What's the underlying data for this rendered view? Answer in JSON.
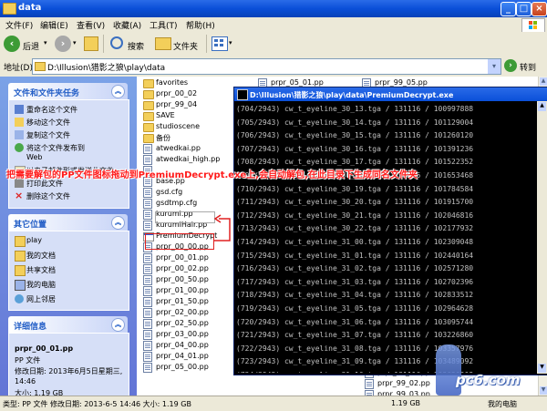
{
  "window": {
    "title": "data"
  },
  "menu": [
    "文件(F)",
    "编辑(E)",
    "查看(V)",
    "收藏(A)",
    "工具(T)",
    "帮助(H)"
  ],
  "toolbar": {
    "back": "后退",
    "search": "搜索",
    "folders": "文件夹"
  },
  "address": {
    "label": "地址(D)",
    "path": "D:\\Illusion\\猎影之狼\\play\\data",
    "go": "转到"
  },
  "tasks": {
    "title": "文件和文件夹任务",
    "items": [
      {
        "label": "重命名这个文件",
        "icon": "rename-icon"
      },
      {
        "label": "移动这个文件",
        "icon": "move-icon"
      },
      {
        "label": "复制这个文件",
        "icon": "copy-icon"
      },
      {
        "label": "将这个文件发布到",
        "label2": "Web",
        "icon": "publish-icon"
      },
      {
        "label": "以电子邮件形式发送此文件",
        "icon": "email-icon"
      },
      {
        "label": "打印此文件",
        "icon": "print-icon"
      },
      {
        "label": "删除这个文件",
        "icon": "delete-icon"
      }
    ]
  },
  "places": {
    "title": "其它位置",
    "items": [
      {
        "label": "play",
        "icon": "folder-icon"
      },
      {
        "label": "我的文档",
        "icon": "my-documents-icon"
      },
      {
        "label": "共享文档",
        "icon": "shared-documents-icon"
      },
      {
        "label": "我的电脑",
        "icon": "my-computer-icon"
      },
      {
        "label": "网上邻居",
        "icon": "network-icon"
      }
    ]
  },
  "details": {
    "title": "详细信息",
    "filename": "prpr_00_01.pp",
    "type": "PP 文件",
    "modified": "修改日期: 2013年6月5日星期三, 14:46",
    "size": "大小: 1.19 GB"
  },
  "files_col1": [
    {
      "name": "favorites",
      "kind": "folder"
    },
    {
      "name": "prpr_00_02",
      "kind": "folder"
    },
    {
      "name": "prpr_99_04",
      "kind": "folder"
    },
    {
      "name": "SAVE",
      "kind": "folder"
    },
    {
      "name": "studioscene",
      "kind": "folder"
    },
    {
      "name": "备份",
      "kind": "folder"
    },
    {
      "name": "atwedkai.pp",
      "kind": "doc"
    },
    {
      "name": "atwedkai_high.pp",
      "kind": "doc"
    },
    {
      "name": "",
      "kind": "doc"
    },
    {
      "name": "base.pp",
      "kind": "doc"
    },
    {
      "name": "gsd.cfg",
      "kind": "doc"
    },
    {
      "name": "gsdtmp.cfg",
      "kind": "doc"
    },
    {
      "name": "kurumi.pp",
      "kind": "doc"
    },
    {
      "name": "kurumiHair.pp",
      "kind": "doc"
    },
    {
      "name": "PremiumDecrypt",
      "kind": "exe"
    },
    {
      "name": "prpr_00_00.pp",
      "kind": "doc"
    },
    {
      "name": "prpr_00_01.pp",
      "kind": "doc"
    },
    {
      "name": "prpr_00_02.pp",
      "kind": "doc"
    },
    {
      "name": "prpr_00_50.pp",
      "kind": "doc"
    },
    {
      "name": "prpr_01_00.pp",
      "kind": "doc"
    },
    {
      "name": "prpr_01_50.pp",
      "kind": "doc"
    },
    {
      "name": "prpr_02_00.pp",
      "kind": "doc"
    },
    {
      "name": "prpr_02_50.pp",
      "kind": "doc"
    },
    {
      "name": "prpr_03_00.pp",
      "kind": "doc"
    },
    {
      "name": "prpr_04_00.pp",
      "kind": "doc"
    },
    {
      "name": "prpr_04_01.pp",
      "kind": "doc"
    },
    {
      "name": "prpr_05_00.pp",
      "kind": "doc"
    }
  ],
  "files_col2_top": [
    {
      "name": "prpr_05_01.pp",
      "kind": "doc"
    },
    {
      "name": "prpr_99_05.pp",
      "kind": "doc"
    }
  ],
  "files_col2_bottom": [
    {
      "name": "prpr_99_01.pp",
      "kind": "doc"
    },
    {
      "name": "prpr_99_02.pp",
      "kind": "doc"
    },
    {
      "name": "prpr_99_03.pp",
      "kind": "doc"
    }
  ],
  "console": {
    "title": "D:\\Illusion\\猎影之狼\\play\\data\\PremiumDecrypt.exe",
    "lines": [
      "(704/2943) cw_t_eyeline_30_13.tga / 131116 / 100997888",
      "(705/2943) cw_t_eyeline_30_14.tga / 131116 / 101129004",
      "(706/2943) cw_t_eyeline_30_15.tga / 131116 / 101260120",
      "(707/2943) cw_t_eyeline_30_16.tga / 131116 / 101391236",
      "(708/2943) cw_t_eyeline_30_17.tga / 131116 / 101522352",
      "(709/2943) cw_t_eyeline_30_18.tga / 131116 / 101653468",
      "(710/2943) cw_t_eyeline_30_19.tga / 131116 / 101784584",
      "(711/2943) cw_t_eyeline_30_20.tga / 131116 / 101915700",
      "(712/2943) cw_t_eyeline_30_21.tga / 131116 / 102046816",
      "(713/2943) cw_t_eyeline_30_22.tga / 131116 / 102177932",
      "(714/2943) cw_t_eyeline_31_00.tga / 131116 / 102309048",
      "(715/2943) cw_t_eyeline_31_01.tga / 131116 / 102440164",
      "(716/2943) cw_t_eyeline_31_02.tga / 131116 / 102571280",
      "(717/2943) cw_t_eyeline_31_03.tga / 131116 / 102702396",
      "(718/2943) cw_t_eyeline_31_04.tga / 131116 / 102833512",
      "(719/2943) cw_t_eyeline_31_05.tga / 131116 / 102964628",
      "(720/2943) cw_t_eyeline_31_06.tga / 131116 / 103095744",
      "(721/2943) cw_t_eyeline_31_07.tga / 131116 / 103226860",
      "(722/2943) cw_t_eyeline_31_08.tga / 131116 / 103357976",
      "(723/2943) cw_t_eyeline_31_09.tga / 131116 / 103489092",
      "(724/2943) cw_t_eyeline_31_10.tga / 131116 / 103620208",
      "(725/2943) cw_t_eyeline_31_11.tga / 131116 / 103751324",
      "(726/2943) cw_t_eyeline_31_12.tga / 131116 / 103882440",
      "(727/2943) cw_t_eyeline_31_13.tga / 131116 / 104013556"
    ]
  },
  "annotation": "把需要解包的PP文件图标拖动到PremiumDecrypt.exe上,会自动解包,在此目录下生成同名文件夹",
  "status": {
    "left": "类型: PP 文件 修改日期: 2013-6-5 14:46 大小: 1.19 GB",
    "size": "1.19 GB",
    "zone": "我的电脑"
  },
  "watermark": "pc6.com",
  "colors": {
    "highlight": "#ff1a1a",
    "titlebar": "#0a4fd8",
    "console_text": "#c0c0c0"
  }
}
